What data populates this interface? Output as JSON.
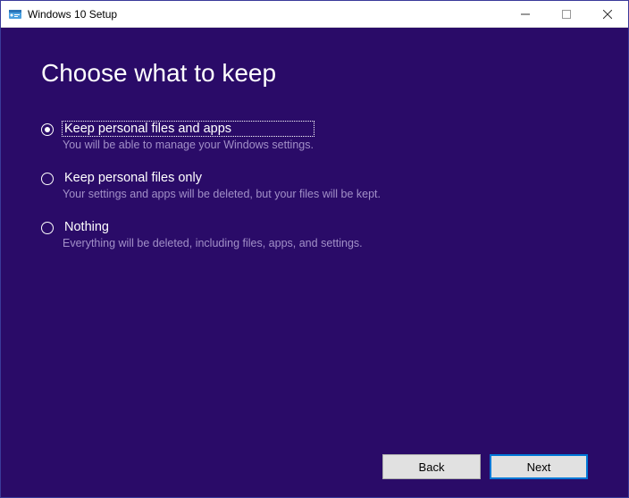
{
  "window": {
    "title": "Windows 10 Setup"
  },
  "heading": "Choose what to keep",
  "options": [
    {
      "label": "Keep personal files and apps",
      "desc": "You will be able to manage your Windows settings.",
      "selected": true
    },
    {
      "label": "Keep personal files only",
      "desc": "Your settings and apps will be deleted, but your files will be kept.",
      "selected": false
    },
    {
      "label": "Nothing",
      "desc": "Everything will be deleted, including files, apps, and settings.",
      "selected": false
    }
  ],
  "footer": {
    "back": "Back",
    "next": "Next"
  }
}
